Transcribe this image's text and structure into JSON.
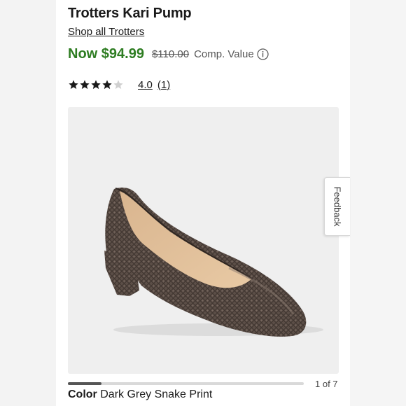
{
  "product": {
    "title": "Trotters Kari Pump",
    "brand_link": "Shop all Trotters"
  },
  "pricing": {
    "now_price": "Now $94.99",
    "original_price": "$110.00",
    "comp_label": "Comp. Value",
    "info_icon": "info-circle-icon",
    "now_color": "#2e7d22"
  },
  "rating": {
    "stars_filled": 4,
    "stars_total": 5,
    "value": "4.0",
    "count": "(1)"
  },
  "gallery": {
    "image_alt": "Dark grey snake print block-heel pump",
    "position": 1,
    "total": 7,
    "counter": "1 of 7"
  },
  "color": {
    "label": "Color",
    "value": "Dark Grey Snake Print"
  },
  "feedback": {
    "label": "Feedback"
  }
}
